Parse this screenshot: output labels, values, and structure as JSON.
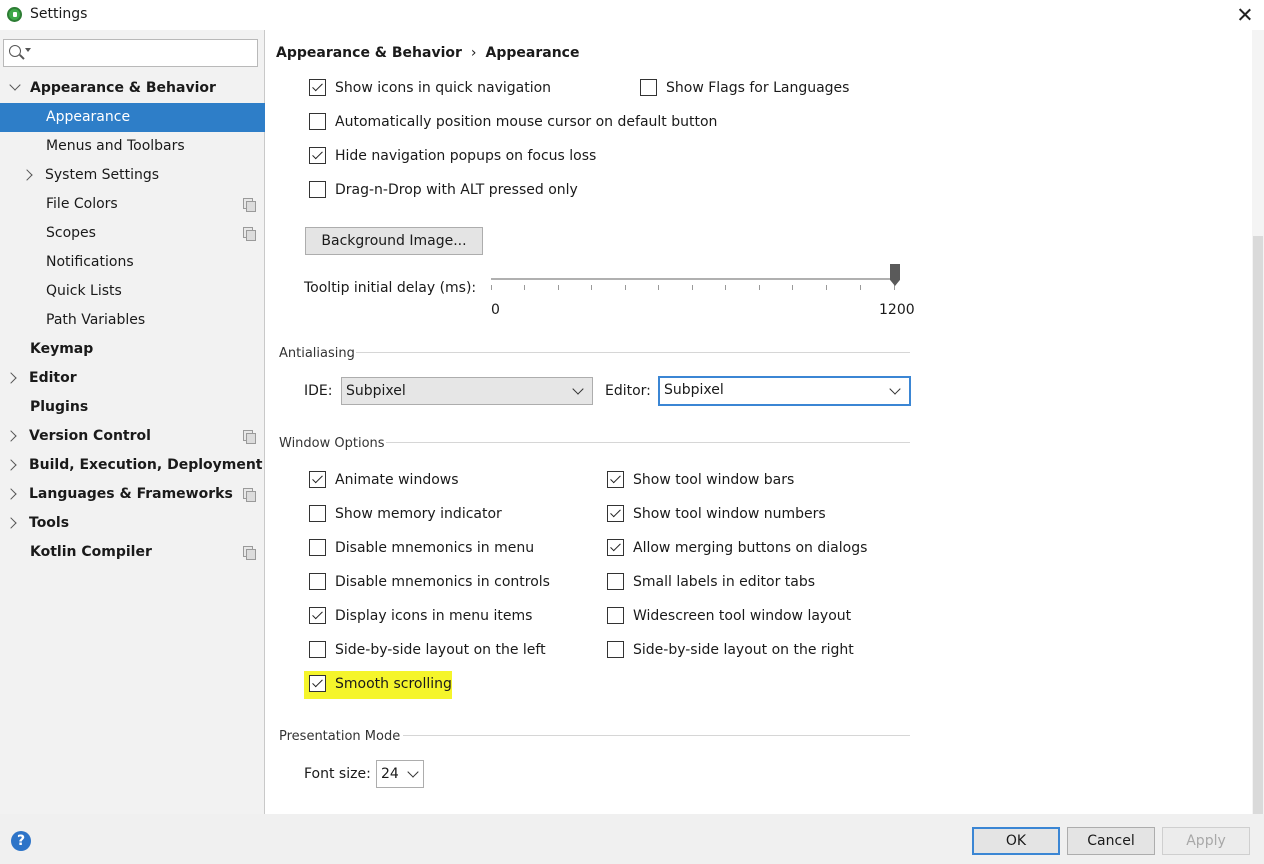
{
  "window": {
    "title": "Settings"
  },
  "search": {
    "placeholder": "",
    "value": ""
  },
  "sidebar": {
    "items": [
      {
        "label": "Appearance & Behavior"
      },
      {
        "label": "Appearance"
      },
      {
        "label": "Menus and Toolbars"
      },
      {
        "label": "System Settings"
      },
      {
        "label": "File Colors"
      },
      {
        "label": "Scopes"
      },
      {
        "label": "Notifications"
      },
      {
        "label": "Quick Lists"
      },
      {
        "label": "Path Variables"
      },
      {
        "label": "Keymap"
      },
      {
        "label": "Editor"
      },
      {
        "label": "Plugins"
      },
      {
        "label": "Version Control"
      },
      {
        "label": "Build, Execution, Deployment"
      },
      {
        "label": "Languages & Frameworks"
      },
      {
        "label": "Tools"
      },
      {
        "label": "Kotlin Compiler"
      }
    ]
  },
  "breadcrumb": {
    "parent": "Appearance & Behavior",
    "separator": "›",
    "current": "Appearance"
  },
  "general": {
    "show_icons_quick_nav": {
      "label": "Show icons in quick navigation",
      "checked": true
    },
    "show_flags_languages": {
      "label": "Show Flags for Languages",
      "checked": false
    },
    "auto_position_cursor": {
      "label": "Automatically position mouse cursor on default button",
      "checked": false
    },
    "hide_nav_popups": {
      "label": "Hide navigation popups on focus loss",
      "checked": true
    },
    "drag_n_drop_alt": {
      "label": "Drag-n-Drop with ALT pressed only",
      "checked": false
    },
    "background_image_button": "Background Image...",
    "tooltip_delay": {
      "label": "Tooltip initial delay (ms):",
      "min": "0",
      "max": "1200",
      "value": 1200
    }
  },
  "antialiasing": {
    "title": "Antialiasing",
    "ide_label": "IDE:",
    "ide_value": "Subpixel",
    "editor_label": "Editor:",
    "editor_value": "Subpixel"
  },
  "window_options": {
    "title": "Window Options",
    "left": [
      {
        "label": "Animate windows",
        "checked": true
      },
      {
        "label": "Show memory indicator",
        "checked": false
      },
      {
        "label": "Disable mnemonics in menu",
        "checked": false
      },
      {
        "label": "Disable mnemonics in controls",
        "checked": false
      },
      {
        "label": "Display icons in menu items",
        "checked": true
      },
      {
        "label": "Side-by-side layout on the left",
        "checked": false
      },
      {
        "label": "Smooth scrolling",
        "checked": true
      }
    ],
    "right": [
      {
        "label": "Show tool window bars",
        "checked": true
      },
      {
        "label": "Show tool window numbers",
        "checked": true
      },
      {
        "label": "Allow merging buttons on dialogs",
        "checked": true
      },
      {
        "label": "Small labels in editor tabs",
        "checked": false
      },
      {
        "label": "Widescreen tool window layout",
        "checked": false
      },
      {
        "label": "Side-by-side layout on the right",
        "checked": false
      }
    ]
  },
  "presentation": {
    "title": "Presentation Mode",
    "font_size_label": "Font size:",
    "font_size_value": "24"
  },
  "footer": {
    "help": "?",
    "ok": "OK",
    "cancel": "Cancel",
    "apply": "Apply"
  },
  "colors": {
    "selection": "#2e7ec8",
    "highlight": "#f5f52b",
    "focus_border": "#3b86d4"
  }
}
